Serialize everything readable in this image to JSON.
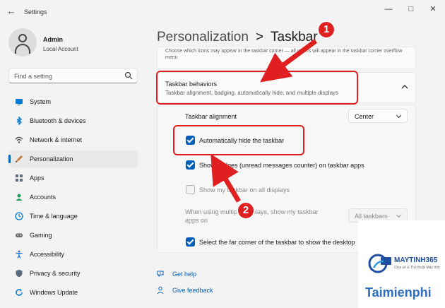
{
  "window": {
    "title": "Settings",
    "controls": [
      "minimize",
      "maximize",
      "close"
    ]
  },
  "user": {
    "name": "Admin",
    "account_type": "Local Account"
  },
  "search": {
    "placeholder": "Find a setting"
  },
  "nav": [
    {
      "label": "System",
      "icon": "monitor-icon",
      "color": "#0078d4"
    },
    {
      "label": "Bluetooth & devices",
      "icon": "bluetooth-icon",
      "color": "#0078d4"
    },
    {
      "label": "Network & internet",
      "icon": "wifi-icon",
      "color": "#4d4d4d"
    },
    {
      "label": "Personalization",
      "icon": "brush-icon",
      "color": "#c17a31",
      "active": true
    },
    {
      "label": "Apps",
      "icon": "apps-icon",
      "color": "#5e6b7a"
    },
    {
      "label": "Accounts",
      "icon": "person-icon",
      "color": "#1f9c5a"
    },
    {
      "label": "Time & language",
      "icon": "globe-clock-icon",
      "color": "#0078d4"
    },
    {
      "label": "Gaming",
      "icon": "gamepad-icon",
      "color": "#6b6b6b"
    },
    {
      "label": "Accessibility",
      "icon": "accessibility-icon",
      "color": "#1a70c8"
    },
    {
      "label": "Privacy & security",
      "icon": "shield-icon",
      "color": "#5a6a7a"
    },
    {
      "label": "Windows Update",
      "icon": "update-icon",
      "color": "#0078d4"
    }
  ],
  "breadcrumb": {
    "parent": "Personalization",
    "separator": ">",
    "current": "Taskbar"
  },
  "overflow_desc": "Choose which icons may appear in the taskbar corner — all others will appear in the taskbar corner overflow menu",
  "behaviors": {
    "title": "Taskbar behaviors",
    "description": "Taskbar alignment, badging, automatically hide, and multiple displays",
    "alignment_label": "Taskbar alignment",
    "alignment_value": "Center",
    "auto_hide_label": "Automatically hide the taskbar",
    "auto_hide_checked": true,
    "badges_label": "Show badges (unread messages counter) on taskbar apps",
    "badges_checked": true,
    "all_displays_label": "Show my taskbar on all displays",
    "all_displays_checked": false,
    "multi_display_label_line1": "When using multiple displays, show my taskbar",
    "multi_display_label_line2": "apps on",
    "multi_display_value": "All taskbars",
    "far_corner_label": "Select the far corner of the taskbar to show the desktop",
    "far_corner_checked": true
  },
  "links": {
    "help": "Get help",
    "feedback": "Give feedback"
  },
  "annotations": {
    "badge1": "1",
    "badge2": "2"
  },
  "watermark": {
    "brand1": "MAYTINH365",
    "brand2": "Chia sẻ & Thủ thuật Máy tính",
    "brand3": "Taimienphi"
  },
  "colors": {
    "accent": "#005fb8",
    "annotation": "#e02020"
  }
}
